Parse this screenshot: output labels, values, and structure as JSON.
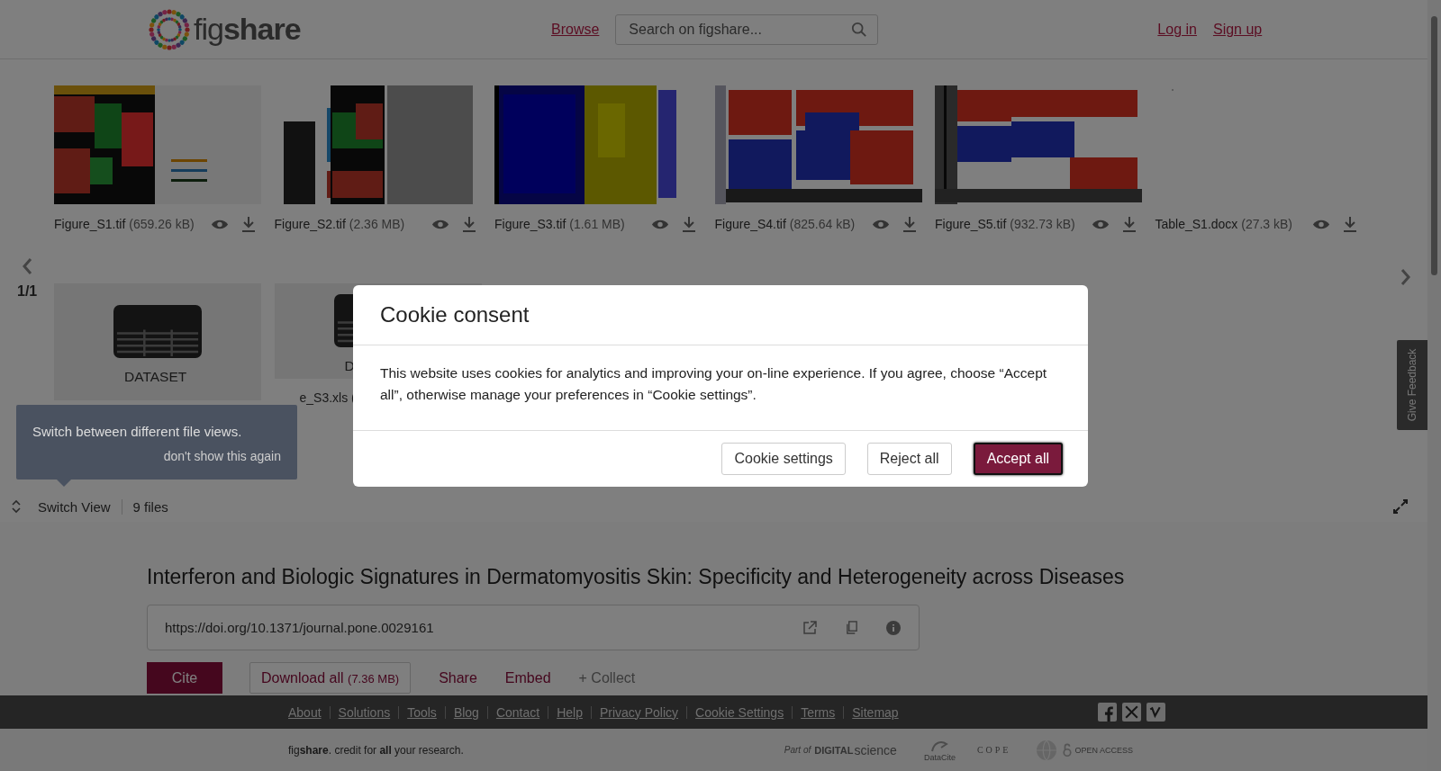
{
  "header": {
    "logo": "fig**share**",
    "browse": "Browse",
    "search": {
      "placeholder": "Search on figshare..."
    },
    "login": "Log in",
    "signup": "Sign up"
  },
  "files": [
    {
      "name": "Figure_S1.tif",
      "size": "(659.26 kB)",
      "kind": "picture"
    },
    {
      "name": "Figure_S2.tif",
      "size": "(2.36 MB)",
      "kind": "picture"
    },
    {
      "name": "Figure_S3.tif",
      "size": "(1.61 MB)",
      "kind": "picture"
    },
    {
      "name": "Figure_S4.tif",
      "size": "(825.64 kB)",
      "kind": "picture"
    },
    {
      "name": "Figure_S5.tif",
      "size": "(932.73 kB)",
      "kind": "picture"
    },
    {
      "name": "Table_S1.docx",
      "size": "(27.3 kB)",
      "kind": "blank"
    }
  ],
  "pager": "1/1",
  "cards": [
    {
      "label": "DATASET"
    },
    {
      "label": "D",
      "caption": "e_S3.xls ("
    }
  ],
  "tooltip": {
    "text": "Switch between different file views.",
    "dismiss": "don't show this again"
  },
  "switch_view": "Switch View",
  "file_count": "9 files",
  "feedback": "Give Feedback",
  "article": {
    "title": "Interferon and Biologic Signatures in Dermatomyositis Skin: Specificity and Heterogeneity across Diseases",
    "doi": "https://doi.org/10.1371/journal.pone.0029161",
    "cite": "Cite",
    "download": "Download all",
    "download_size": "(7.36 MB)",
    "share": "Share",
    "embed": "Embed",
    "collect": "+ Collect"
  },
  "footer_links": [
    "About",
    "Solutions",
    "Tools",
    "Blog",
    "Contact",
    "Help",
    "Privacy Policy",
    "Cookie Settings",
    "Terms",
    "Sitemap"
  ],
  "tagline": "fig**share**. credit for **all** your research.",
  "partners": {
    "part_of": "Part of",
    "digital": "DIGITAL",
    "science": "science",
    "datacite": "DataCite",
    "cope": "COPE",
    "open": "OPEN ACCESS"
  },
  "modal": {
    "title": "Cookie consent",
    "body": "This website uses cookies for analytics and improving your on-line experience. If you agree, choose “Accept all”, otherwise manage your preferences in “Cookie settings”.",
    "buttons": [
      {
        "label": "Cookie settings",
        "primary": false
      },
      {
        "label": "Reject all",
        "primary": false
      },
      {
        "label": "Accept all",
        "primary": true
      }
    ]
  }
}
